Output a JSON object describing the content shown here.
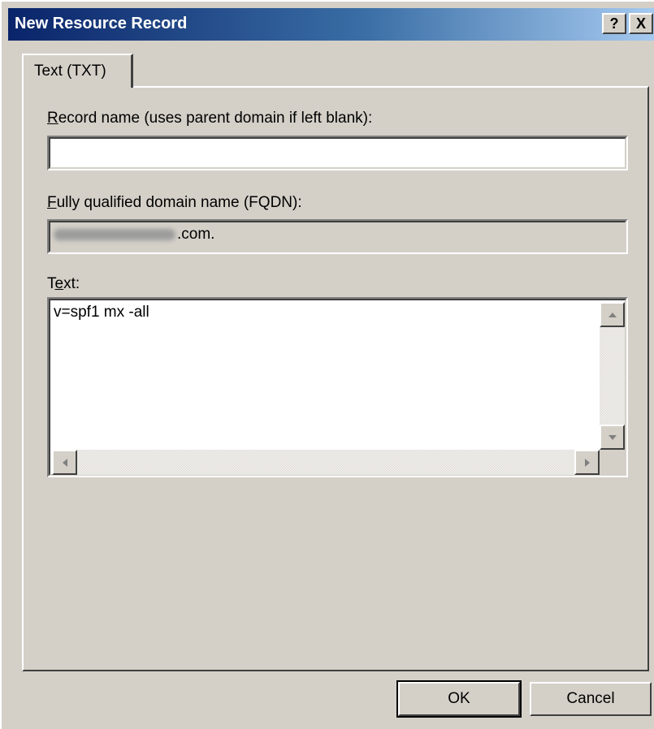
{
  "window": {
    "title": "New Resource Record",
    "help_glyph": "?",
    "close_glyph": "X"
  },
  "tab": {
    "label": "Text (TXT)"
  },
  "record_name": {
    "label_accel": "R",
    "label_rest": "ecord name (uses parent domain if left blank):",
    "value": ""
  },
  "fqdn": {
    "label_accel": "F",
    "label_rest": "ully qualified domain name (FQDN):",
    "value_suffix": ".com."
  },
  "text": {
    "label_pre": "T",
    "label_accel": "e",
    "label_rest": "xt:",
    "value": "v=spf1 mx -all"
  },
  "buttons": {
    "ok": "OK",
    "cancel": "Cancel"
  },
  "icons": {
    "help": "help-icon",
    "close": "close-icon",
    "scroll_up": "arrow-up-icon",
    "scroll_down": "arrow-down-icon",
    "scroll_left": "arrow-left-icon",
    "scroll_right": "arrow-right-icon"
  },
  "colors": {
    "title_gradient_start": "#0a246a",
    "title_gradient_end": "#a6caf0",
    "face": "#d4d0c8"
  }
}
